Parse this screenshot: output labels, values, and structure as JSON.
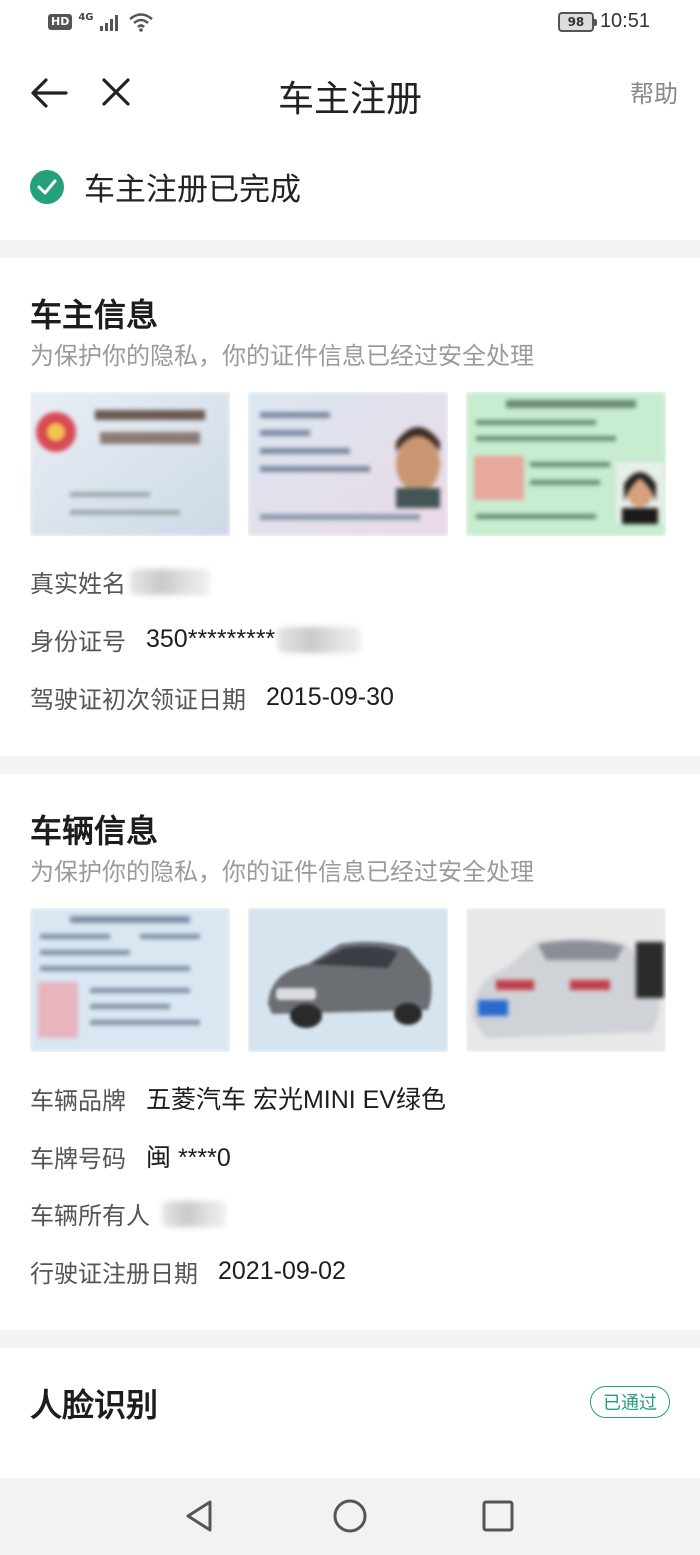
{
  "status_bar": {
    "hd": "HD",
    "network": "4G",
    "battery": "98",
    "time": "10:51"
  },
  "nav": {
    "title": "车主注册",
    "help": "帮助"
  },
  "complete": {
    "text": "车主注册已完成"
  },
  "owner": {
    "title": "车主信息",
    "subtitle": "为保护你的隐私，你的证件信息已经过安全处理",
    "rows": [
      {
        "label": "真实姓名",
        "value": ""
      },
      {
        "label": "身份证号",
        "value": "350*********"
      },
      {
        "label": "驾驶证初次领证日期",
        "value": "2015-09-30"
      }
    ]
  },
  "vehicle": {
    "title": "车辆信息",
    "subtitle": "为保护你的隐私，你的证件信息已经过安全处理",
    "rows": [
      {
        "label": "车辆品牌",
        "value": "五菱汽车 宏光MINI EV绿色"
      },
      {
        "label": "车牌号码",
        "value": "闽 ****0"
      },
      {
        "label": "车辆所有人",
        "value": ""
      },
      {
        "label": "行驶证注册日期",
        "value": "2021-09-02"
      }
    ]
  },
  "face": {
    "title": "人脸识别",
    "status": "已通过"
  },
  "colors": {
    "accent": "#24a07c",
    "background": "#f2f3f4"
  }
}
